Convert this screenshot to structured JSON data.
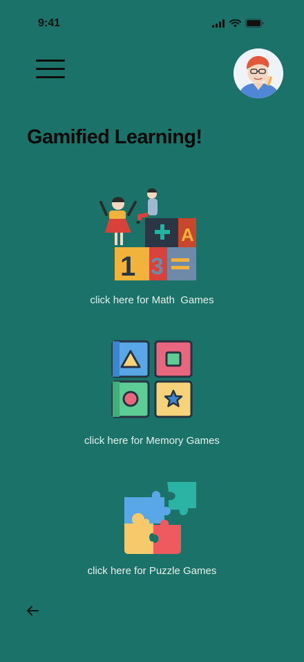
{
  "status_bar": {
    "time": "9:41",
    "icons": [
      "signal-icon",
      "wifi-icon",
      "battery-icon"
    ]
  },
  "header": {
    "menu_icon": "hamburger-menu-icon",
    "avatar": "user-avatar"
  },
  "page": {
    "title": "Gamified Learning!"
  },
  "games": [
    {
      "icon": "math-illustration-icon",
      "label": "click here for Math  Games"
    },
    {
      "icon": "memory-shapes-icon",
      "label": "click here for Memory Games"
    },
    {
      "icon": "puzzle-pieces-icon",
      "label": "click here for Puzzle Games"
    }
  ],
  "footer": {
    "back_icon": "arrow-left-icon"
  },
  "colors": {
    "background": "#1b7268",
    "text_dark": "#0a0a0a",
    "label_text": "#e8f2ef"
  }
}
